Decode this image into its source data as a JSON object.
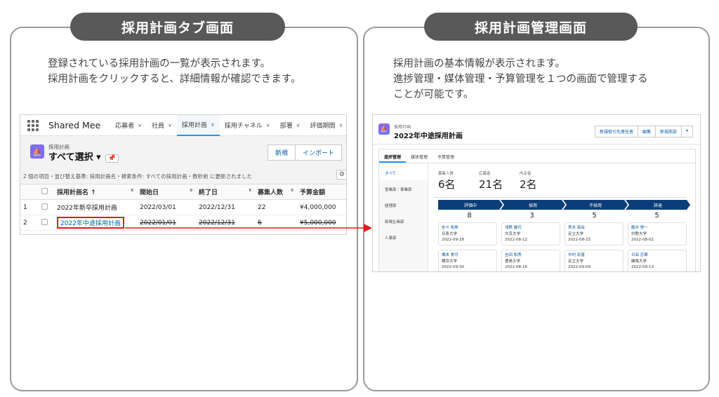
{
  "left_panel": {
    "title": "採用計画タブ画面",
    "description": [
      "登録されている採用計画の一覧が表示されます。",
      "採用計画をクリックすると、詳細情報が確認できます。"
    ]
  },
  "right_panel": {
    "title": "採用計画管理画面",
    "description": [
      "採用計画の基本情報が表示されます。",
      "進捗管理・媒体管理・予算管理を１つの画面で管理する",
      "ことが可能です。"
    ]
  },
  "list_screen": {
    "app_name": "Shared Mee",
    "nav_items": [
      "応募者",
      "社員",
      "採用計画",
      "採用チャネル",
      "部署",
      "評価期間"
    ],
    "active_nav": "採用計画",
    "object_label": "採用計画",
    "view_title": "すべて選択",
    "buttons": [
      "新規",
      "インポート"
    ],
    "meta": "2 個の項目・並び替え基準: 採用計画名・検索条件: すべての採用計画・数秒前 に更新されました",
    "columns": [
      "採用計画名 ↑",
      "開始日",
      "終了日",
      "募集人数",
      "予算金額"
    ],
    "rows": [
      {
        "num": "1",
        "name": "2022年新卒採用計画",
        "start": "2022/03/01",
        "end": "2022/12/31",
        "headcount": "22",
        "budget": "¥4,000,000"
      },
      {
        "num": "2",
        "name": "2022年中途採用計画",
        "start": "2022/01/01",
        "end": "2022/12/31",
        "headcount": "6",
        "budget": "¥5,000,000"
      }
    ],
    "highlight_color": "#e21a1a"
  },
  "detail_screen": {
    "object_label": "採用計画",
    "record_title": "2022年中途採用計画",
    "buttons": [
      "新規取引先責任者",
      "編集",
      "新規商談"
    ],
    "tabs": [
      "進捗管理",
      "媒体管理",
      "予算管理"
    ],
    "side_items": [
      "すべて",
      "営業部｜事業部",
      "経理部",
      "新規企画部",
      "人事部"
    ],
    "stats": [
      {
        "label": "募集人数",
        "value": "6名"
      },
      {
        "label": "応募者",
        "value": "21名"
      },
      {
        "label": "内定者",
        "value": "2名"
      }
    ],
    "stages": [
      {
        "label": "評価中",
        "count": "8"
      },
      {
        "label": "採用",
        "count": "3"
      },
      {
        "label": "不採用",
        "count": "5"
      },
      {
        "label": "辞退",
        "count": "5"
      }
    ],
    "cards": [
      {
        "name": "佐々 和希",
        "school": "日系大学",
        "date": "2022-09-28"
      },
      {
        "name": "浅野 春代",
        "school": "文京大学",
        "date": "2022-08-12"
      },
      {
        "name": "実本 真由",
        "school": "足立大学",
        "date": "2022-08-23"
      },
      {
        "name": "藤井 崇一",
        "school": "中野大学",
        "date": "2022-08-02"
      },
      {
        "name": "橋本 美可",
        "school": "横浜大学",
        "date": "2022-09-30"
      },
      {
        "name": "吉田 和秀",
        "school": "豊島大学",
        "date": "2022-08-16"
      },
      {
        "name": "中村 宏蓮",
        "school": "足立大学",
        "date": "2022-09-09"
      },
      {
        "name": "日高 恋華",
        "school": "練馬大学",
        "date": "2022-09-13"
      }
    ],
    "stage_color": "#0b3e78"
  }
}
